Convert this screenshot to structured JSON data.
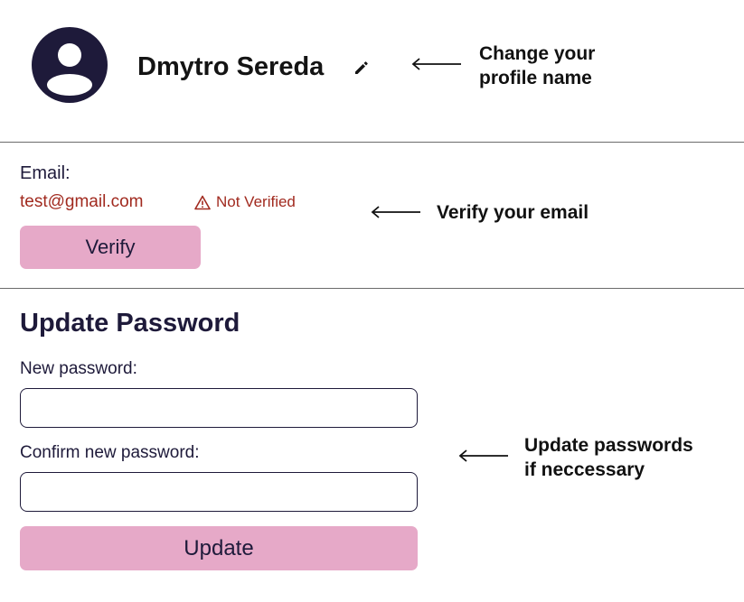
{
  "profile": {
    "name": "Dmytro Sereda",
    "avatar_icon": "user-avatar-icon",
    "edit_icon": "pencil-icon",
    "note": [
      "Change your",
      "profile name"
    ]
  },
  "email": {
    "label": "Email:",
    "value": "test@gmail.com",
    "status": "Not Verified",
    "status_icon": "warning-triangle-icon",
    "verify_label": "Verify",
    "note": "Verify your email"
  },
  "password": {
    "title": "Update Password",
    "new_label": "New password:",
    "new_value": "",
    "confirm_label": "Confirm new password:",
    "confirm_value": "",
    "update_label": "Update",
    "note": [
      "Update passwords",
      "if neccessary"
    ]
  },
  "colors": {
    "primary_text": "#1e1a3a",
    "error": "#a12a1f",
    "button": "#e6a9c8",
    "divider": "#6b6b6b"
  }
}
